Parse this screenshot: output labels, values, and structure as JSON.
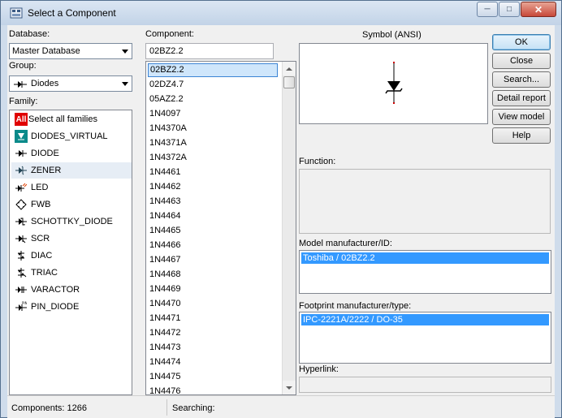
{
  "window": {
    "title": "Select a Component",
    "buttons": {
      "minimize": "─",
      "maximize": "□",
      "close": "✕"
    }
  },
  "database": {
    "label": "Database:",
    "value": "Master Database"
  },
  "group": {
    "label": "Group:",
    "value": "Diodes"
  },
  "family": {
    "label": "Family:",
    "items": [
      {
        "label": "Select all families",
        "icon": "all-icon",
        "icon_text": "All"
      },
      {
        "label": "DIODES_VIRTUAL",
        "icon": "diode-virtual-icon"
      },
      {
        "label": "DIODE",
        "icon": "diode-icon"
      },
      {
        "label": "ZENER",
        "icon": "zener-icon"
      },
      {
        "label": "LED",
        "icon": "led-icon"
      },
      {
        "label": "FWB",
        "icon": "bridge-rectifier-icon"
      },
      {
        "label": "SCHOTTKY_DIODE",
        "icon": "schottky-icon"
      },
      {
        "label": "SCR",
        "icon": "scr-icon"
      },
      {
        "label": "DIAC",
        "icon": "diac-icon"
      },
      {
        "label": "TRIAC",
        "icon": "triac-icon"
      },
      {
        "label": "VARACTOR",
        "icon": "varactor-icon"
      },
      {
        "label": "PIN_DIODE",
        "icon": "pin-diode-icon"
      }
    ],
    "selected": "ZENER"
  },
  "component": {
    "label": "Component:",
    "search_value": "02BZ2.2",
    "items": [
      "02BZ2.2",
      "02DZ4.7",
      "05AZ2.2",
      "1N4097",
      "1N4370A",
      "1N4371A",
      "1N4372A",
      "1N4461",
      "1N4462",
      "1N4463",
      "1N4464",
      "1N4465",
      "1N4466",
      "1N4467",
      "1N4468",
      "1N4469",
      "1N4470",
      "1N4471",
      "1N4472",
      "1N4473",
      "1N4474",
      "1N4475",
      "1N4476"
    ]
  },
  "symbol": {
    "label": "Symbol (ANSI)"
  },
  "function": {
    "label": "Function:"
  },
  "model": {
    "label": "Model manufacturer/ID:",
    "value": "Toshiba / 02BZ2.2"
  },
  "footprint": {
    "label": "Footprint manufacturer/type:",
    "value": "IPC-2221A/2222 / DO-35"
  },
  "hyperlink": {
    "label": "Hyperlink:"
  },
  "buttons": {
    "ok": "OK",
    "close": "Close",
    "search": "Search...",
    "detail_report": "Detail report",
    "view_model": "View model",
    "help": "Help"
  },
  "status": {
    "components": "Components: 1266",
    "searching": "Searching:"
  },
  "colors": {
    "selection": "#3399ff",
    "accent_red": "#cc0000",
    "teal": "#008080"
  }
}
